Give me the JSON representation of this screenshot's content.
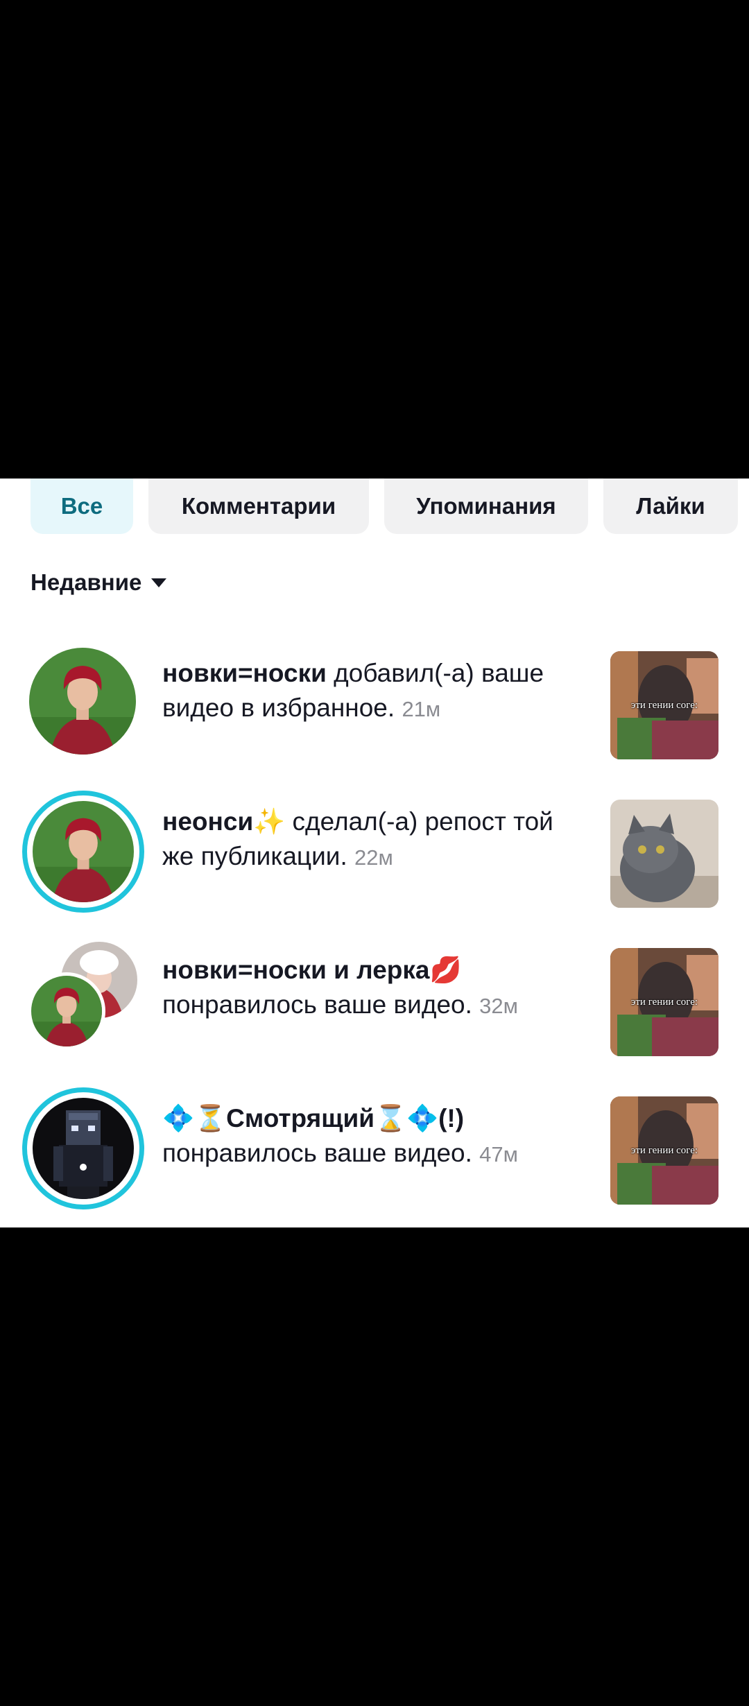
{
  "tabs": [
    {
      "label": "Все",
      "active": true
    },
    {
      "label": "Комментарии",
      "active": false
    },
    {
      "label": "Упоминания",
      "active": false
    },
    {
      "label": "Лайки",
      "active": false
    }
  ],
  "sort": {
    "label": "Недавние",
    "icon": "caret-down-icon"
  },
  "notifications": [
    {
      "name": "новки=носки",
      "action": " добавил(-а) ваше видео в избранное.",
      "time": "21м",
      "avatar": "person-red-hair-avatar",
      "story_ring": false,
      "thumb_caption": "эти гении соге:"
    },
    {
      "name": "неонси✨",
      "action": " сделал(-а) репост той же публикации.",
      "time": "22м",
      "avatar": "person-red-hair-avatar",
      "story_ring": true,
      "thumb_caption": ""
    },
    {
      "name": "новки=носки и лерка💋",
      "action": " понравилось ваше видео.",
      "time": "32м",
      "avatar": "group-avatars",
      "story_ring": false,
      "thumb_caption": "эти гении соге:"
    },
    {
      "name": "💠⏳Смотрящий⌛💠(!)",
      "action": " понравилось ваше видео.",
      "time": "47м",
      "avatar": "minecraft-character-avatar",
      "story_ring": true,
      "thumb_caption": "эти гении соге:"
    }
  ],
  "colors": {
    "accent": "#20c4dc",
    "active_tab_bg": "#e6f7fb",
    "active_tab_text": "#0e6c7f"
  }
}
